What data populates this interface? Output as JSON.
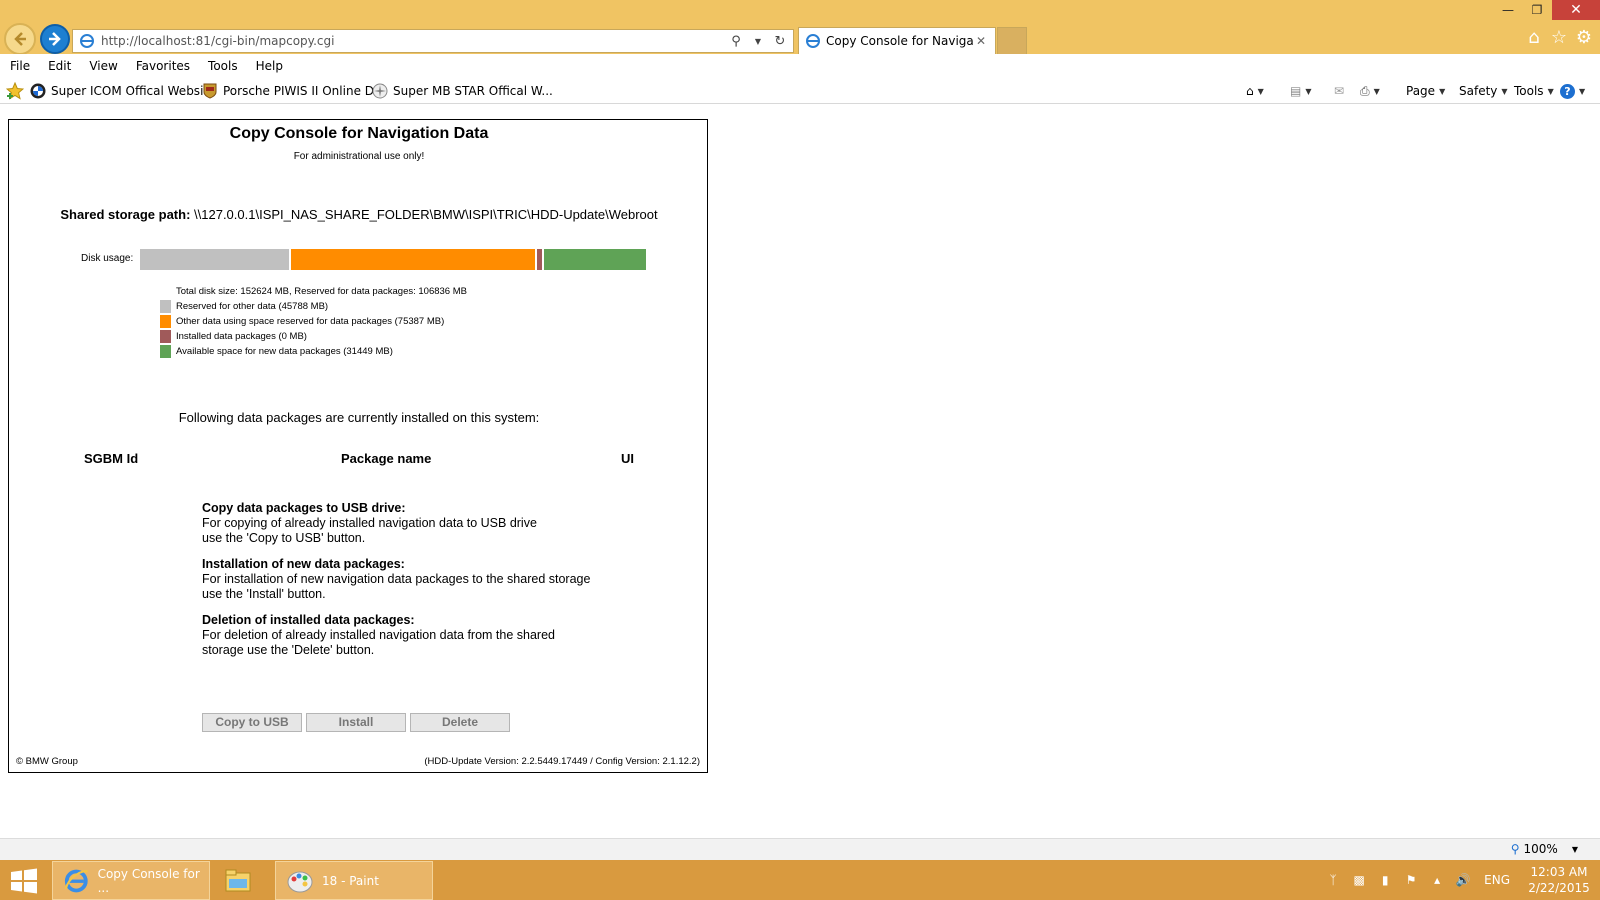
{
  "browser": {
    "url": "http://localhost:81/cgi-bin/mapcopy.cgi",
    "tab_title": "Copy Console for Navigatio...",
    "menu": [
      "File",
      "Edit",
      "View",
      "Favorites",
      "Tools",
      "Help"
    ],
    "favorites": [
      "Super ICOM Offical Websi...",
      "Porsche PIWIS II Online D...",
      "Super MB STAR Offical W..."
    ],
    "commands": {
      "page": "Page",
      "safety": "Safety",
      "tools": "Tools"
    },
    "zoom": "100%"
  },
  "page": {
    "title": "Copy Console for Navigation Data",
    "subtitle": "For administrational use only!",
    "storage_label": "Shared storage path:",
    "storage_path": "\\\\127.0.0.1\\ISPI_NAS_SHARE_FOLDER\\BMW\\ISPI\\TRIC\\HDD-Update\\Webroot",
    "disk_usage_label": "Disk usage:",
    "disk": {
      "total_line": "Total disk size: 152624 MB, Reserved for data packages: 106836 MB",
      "segments": [
        {
          "label": "Reserved for other data (45788 MB)",
          "mb": 45788,
          "color": "#c0c0c0"
        },
        {
          "label": "Other data using space reserved for data packages (75387 MB)",
          "mb": 75387,
          "color": "#ff8c00"
        },
        {
          "label": "Installed data packages (0 MB)",
          "mb": 0,
          "color": "#a05a5a"
        },
        {
          "label": "Available space for new data packages (31449 MB)",
          "mb": 31449,
          "color": "#5fa356"
        }
      ]
    },
    "installed_heading": "Following data packages are currently installed on this system:",
    "columns": {
      "id": "SGBM Id",
      "name": "Package name",
      "ui": "UI"
    },
    "info": [
      {
        "title": "Copy data packages to USB drive:",
        "lines": [
          "For copying of already installed navigation data to USB drive",
          "use the 'Copy to USB' button."
        ]
      },
      {
        "title": "Installation of new data packages:",
        "lines": [
          "For installation of new navigation data packages to the shared storage",
          "use the 'Install' button."
        ]
      },
      {
        "title": "Deletion of installed data packages:",
        "lines": [
          "For deletion of already installed navigation data from the shared",
          "storage use the 'Delete' button."
        ]
      }
    ],
    "buttons": {
      "copy": "Copy to USB",
      "install": "Install",
      "delete": "Delete"
    },
    "copyright": "© BMW Group",
    "version": "(HDD-Update Version: 2.2.5449.17449 / Config Version: 2.1.12.2)"
  },
  "taskbar": {
    "tasks": [
      "Copy Console for ...",
      "18 - Paint"
    ],
    "language": "ENG",
    "time": "12:03 AM",
    "date": "2/22/2015"
  }
}
